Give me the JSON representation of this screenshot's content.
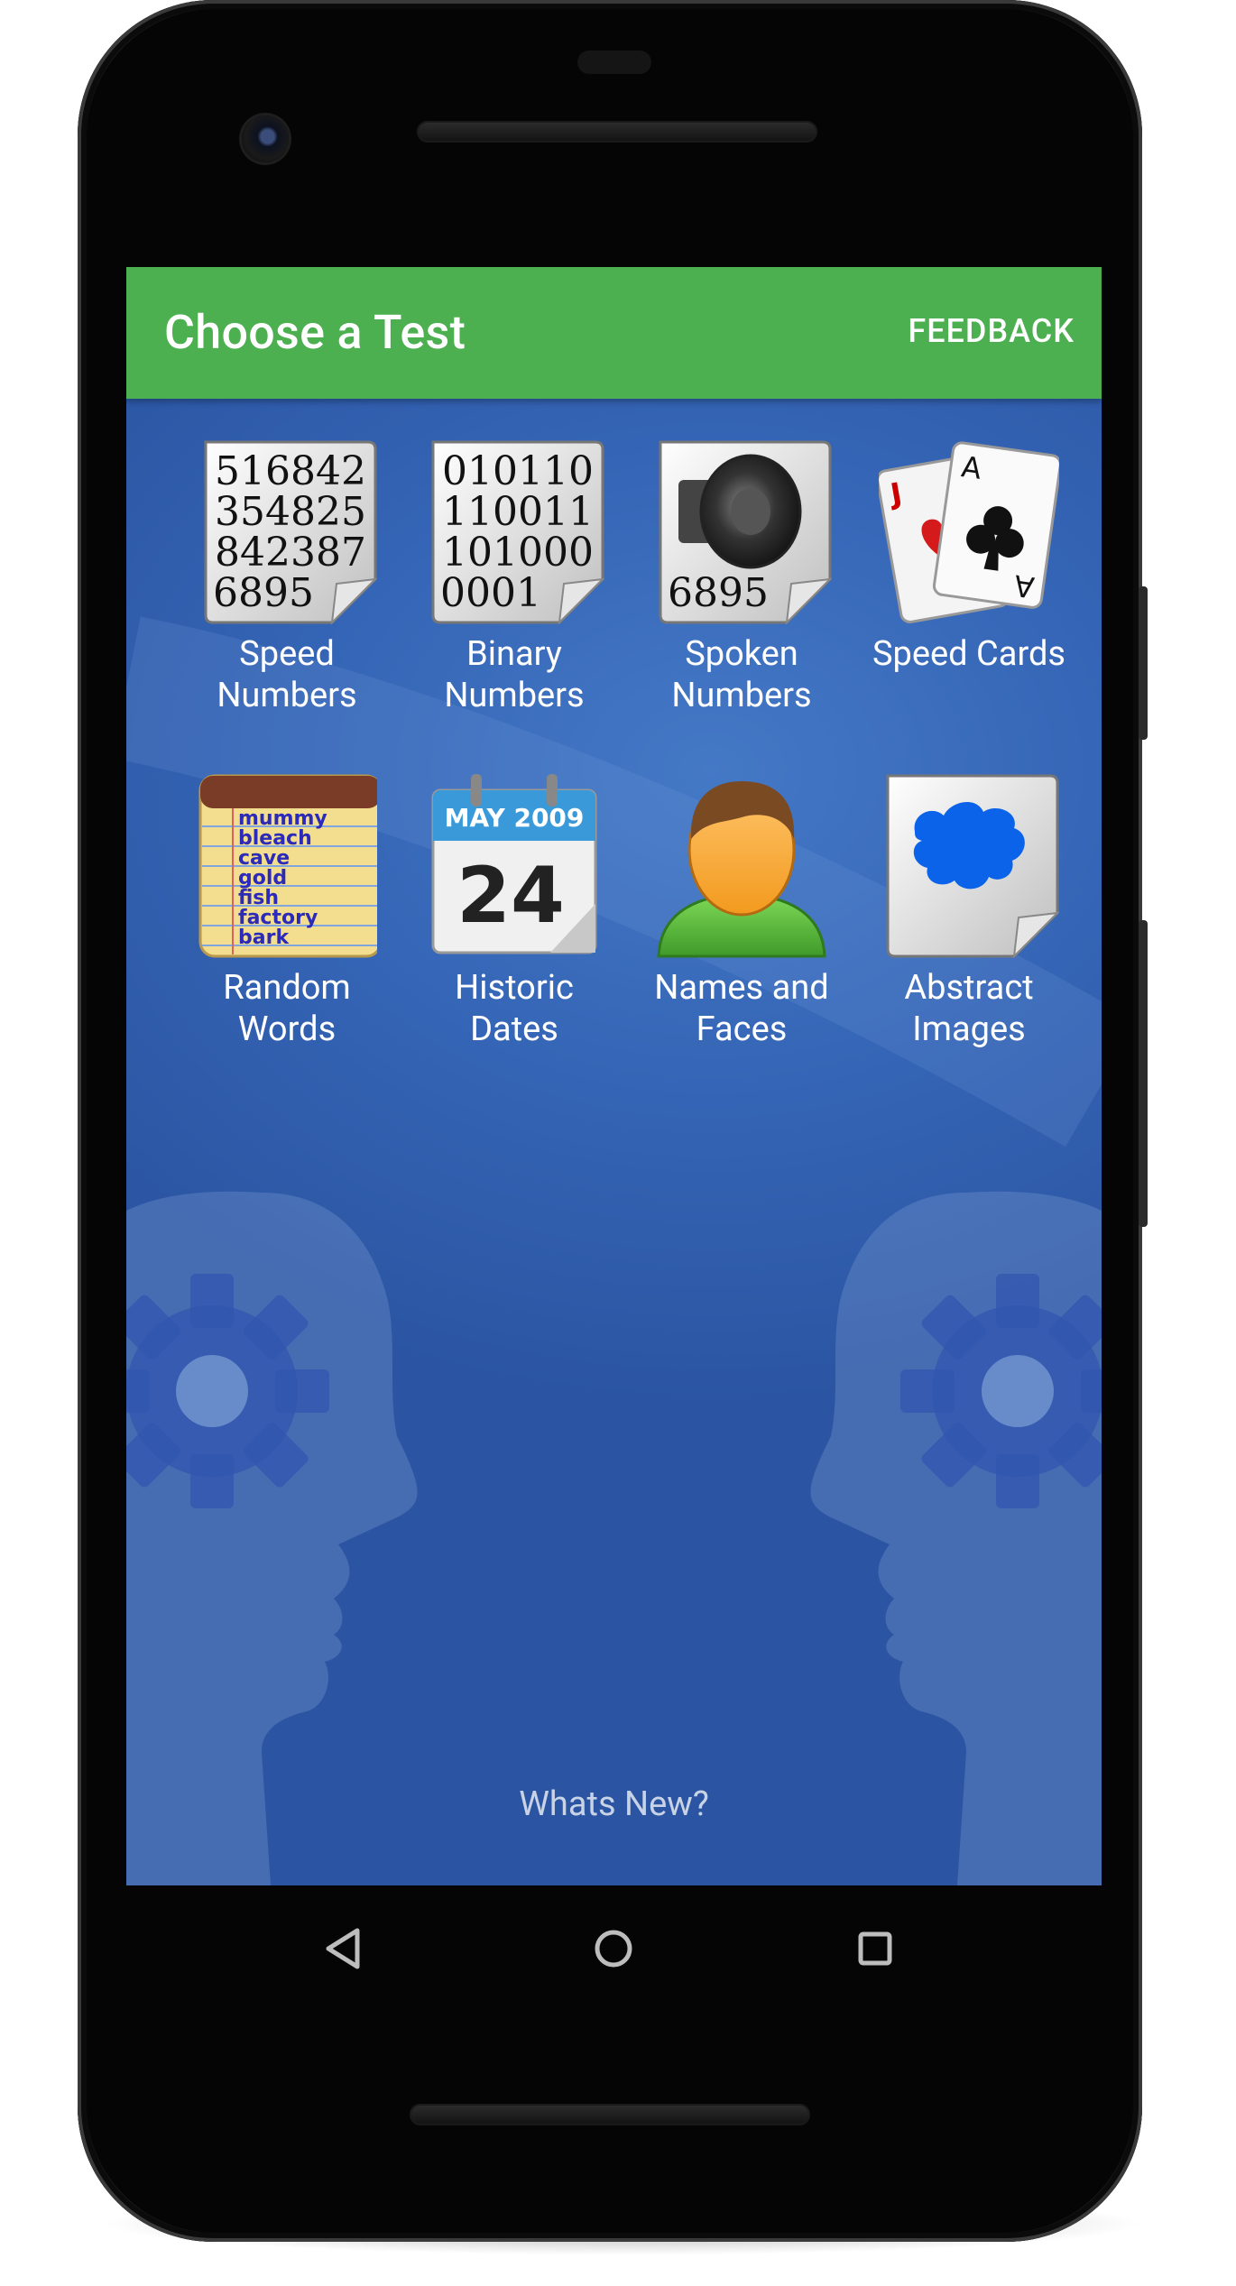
{
  "app_bar": {
    "title": "Choose a Test",
    "feedback_label": "FEEDBACK"
  },
  "tests": [
    {
      "label": "Speed\nNumbers",
      "icon": "speed-numbers-icon",
      "icon_text": [
        "516842",
        "354825",
        "842387",
        "6895"
      ]
    },
    {
      "label": "Binary\nNumbers",
      "icon": "binary-numbers-icon",
      "icon_text": [
        "010110",
        "110011",
        "101000",
        "0001"
      ]
    },
    {
      "label": "Spoken\nNumbers",
      "icon": "speaker-icon",
      "icon_text": [
        "6895"
      ]
    },
    {
      "label": "Speed Cards",
      "icon": "playing-cards-icon",
      "icon_text": [
        "J",
        "A",
        "A"
      ]
    },
    {
      "label": "Random\nWords",
      "icon": "notepad-icon",
      "icon_text": [
        "mummy",
        "bleach",
        "cave",
        "gold",
        "fish",
        "factory",
        "bark"
      ]
    },
    {
      "label": "Historic\nDates",
      "icon": "calendar-icon",
      "icon_text": [
        "MAY 2009",
        "24"
      ]
    },
    {
      "label": "Names and\nFaces",
      "icon": "person-icon",
      "icon_text": []
    },
    {
      "label": "Abstract\nImages",
      "icon": "abstract-image-icon",
      "icon_text": []
    }
  ],
  "footer": {
    "whats_new_label": "Whats New?"
  },
  "nav_bar": {
    "back": "back-icon",
    "home": "home-icon",
    "recents": "recents-icon"
  },
  "colors": {
    "app_bar": "#4caf50",
    "background": "#3565b6",
    "text": "#ffffff"
  }
}
